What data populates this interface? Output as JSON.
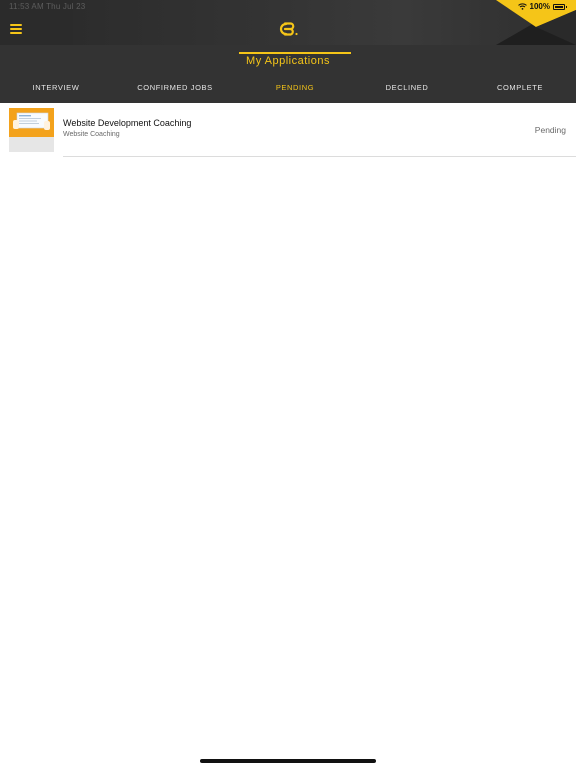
{
  "status_bar": {
    "time_date": "11:53 AM   Thu Jul 23",
    "battery": "100%"
  },
  "nav": {
    "menu_icon": "hamburger-menu-icon",
    "logo_icon": "cb-logo-icon"
  },
  "page": {
    "title": "My Applications"
  },
  "tabs": [
    {
      "label": "INTERVIEW",
      "active": false
    },
    {
      "label": "CONFIRMED JOBS",
      "active": false
    },
    {
      "label": "PENDING",
      "active": true
    },
    {
      "label": "DECLINED",
      "active": false
    },
    {
      "label": "COMPLETE",
      "active": false
    }
  ],
  "applications": [
    {
      "title": "Website Development Coaching",
      "subtitle": "Website Coaching",
      "status": "Pending",
      "thumbnail_icon": "website-coaching-thumbnail"
    }
  ],
  "colors": {
    "accent": "#f5c518",
    "header_dark": "#333333",
    "topbar_dark": "#2b2b2b",
    "background": "#ffffff"
  }
}
